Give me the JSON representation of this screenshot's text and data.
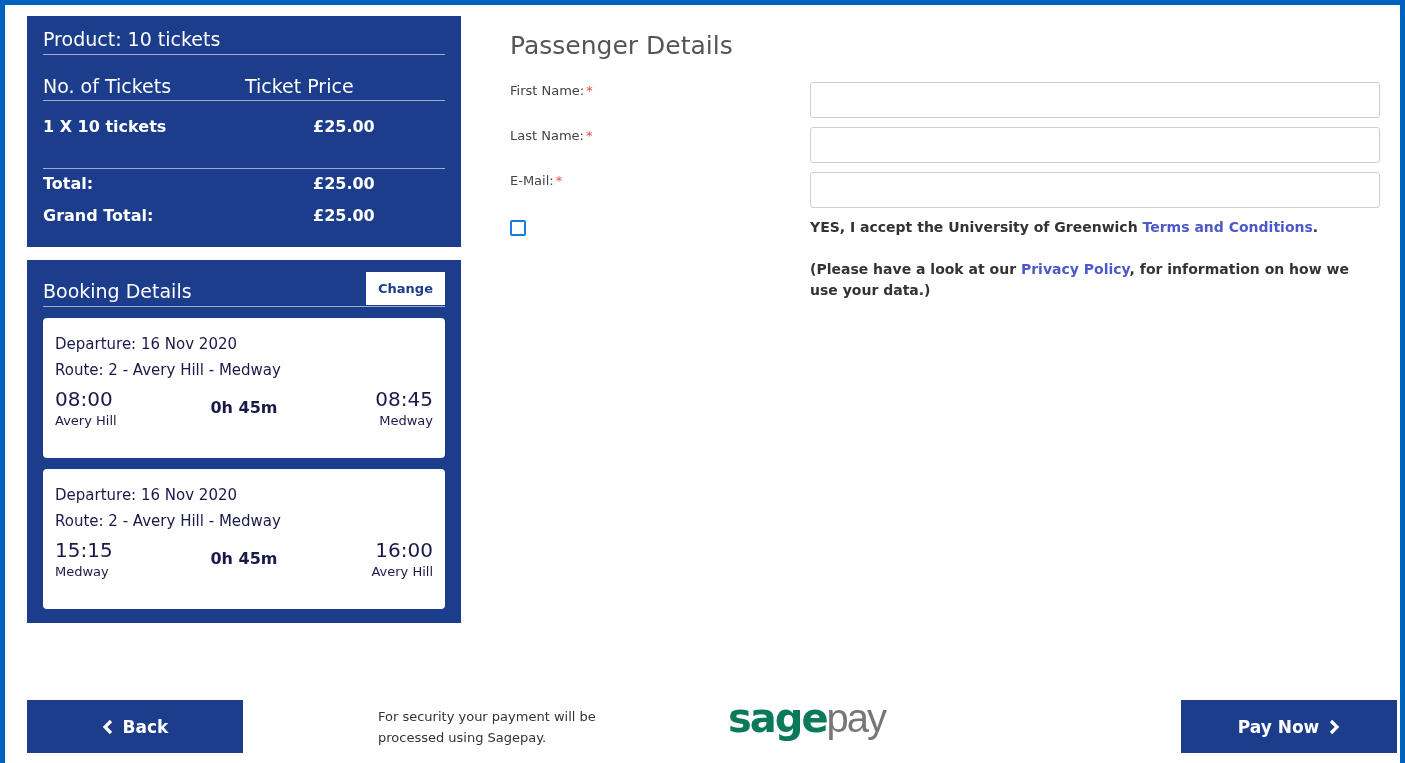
{
  "product": {
    "title": "Product: 10 tickets",
    "columns": [
      "No. of Tickets",
      "Ticket Price"
    ],
    "items": [
      {
        "quantity": "1 X 10 tickets",
        "price": "£25.00"
      }
    ],
    "totals": [
      {
        "label": "Total:",
        "amount": "£25.00"
      },
      {
        "label": "Grand Total:",
        "amount": "£25.00"
      }
    ]
  },
  "booking": {
    "title": "Booking Details",
    "change_button": "Change",
    "journeys": [
      {
        "departure": "Departure: 16 Nov 2020",
        "route": "Route: 2 - Avery Hill - Medway",
        "dep_time": "08:00",
        "dep_place": "Avery Hill",
        "duration": "0h 45m",
        "arr_time": "08:45",
        "arr_place": "Medway"
      },
      {
        "departure": "Departure: 16 Nov 2020",
        "route": "Route: 2 - Avery Hill - Medway",
        "dep_time": "15:15",
        "dep_place": "Medway",
        "duration": "0h 45m",
        "arr_time": "16:00",
        "arr_place": "Avery Hill"
      }
    ]
  },
  "passenger": {
    "title": "Passenger Details",
    "fields": [
      {
        "label": "First Name:",
        "required_mark": "*"
      },
      {
        "label": "Last Name:",
        "required_mark": "*"
      },
      {
        "label": "E-Mail:",
        "required_mark": "*"
      }
    ],
    "consent": {
      "checked": false,
      "before": "YES, I accept the University of Greenwich ",
      "link": "Terms and Conditions",
      "after": "."
    },
    "privacy": {
      "before": "(Please have a look at our ",
      "link": "Privacy Policy",
      "after": ", for information on how we use your data.)"
    }
  },
  "footer": {
    "back_button": "Back",
    "security_note": "For security your payment will be processed using Sagepay.",
    "logo": {
      "first": "sage",
      "second": "pay"
    },
    "pay_button": "Pay Now"
  }
}
